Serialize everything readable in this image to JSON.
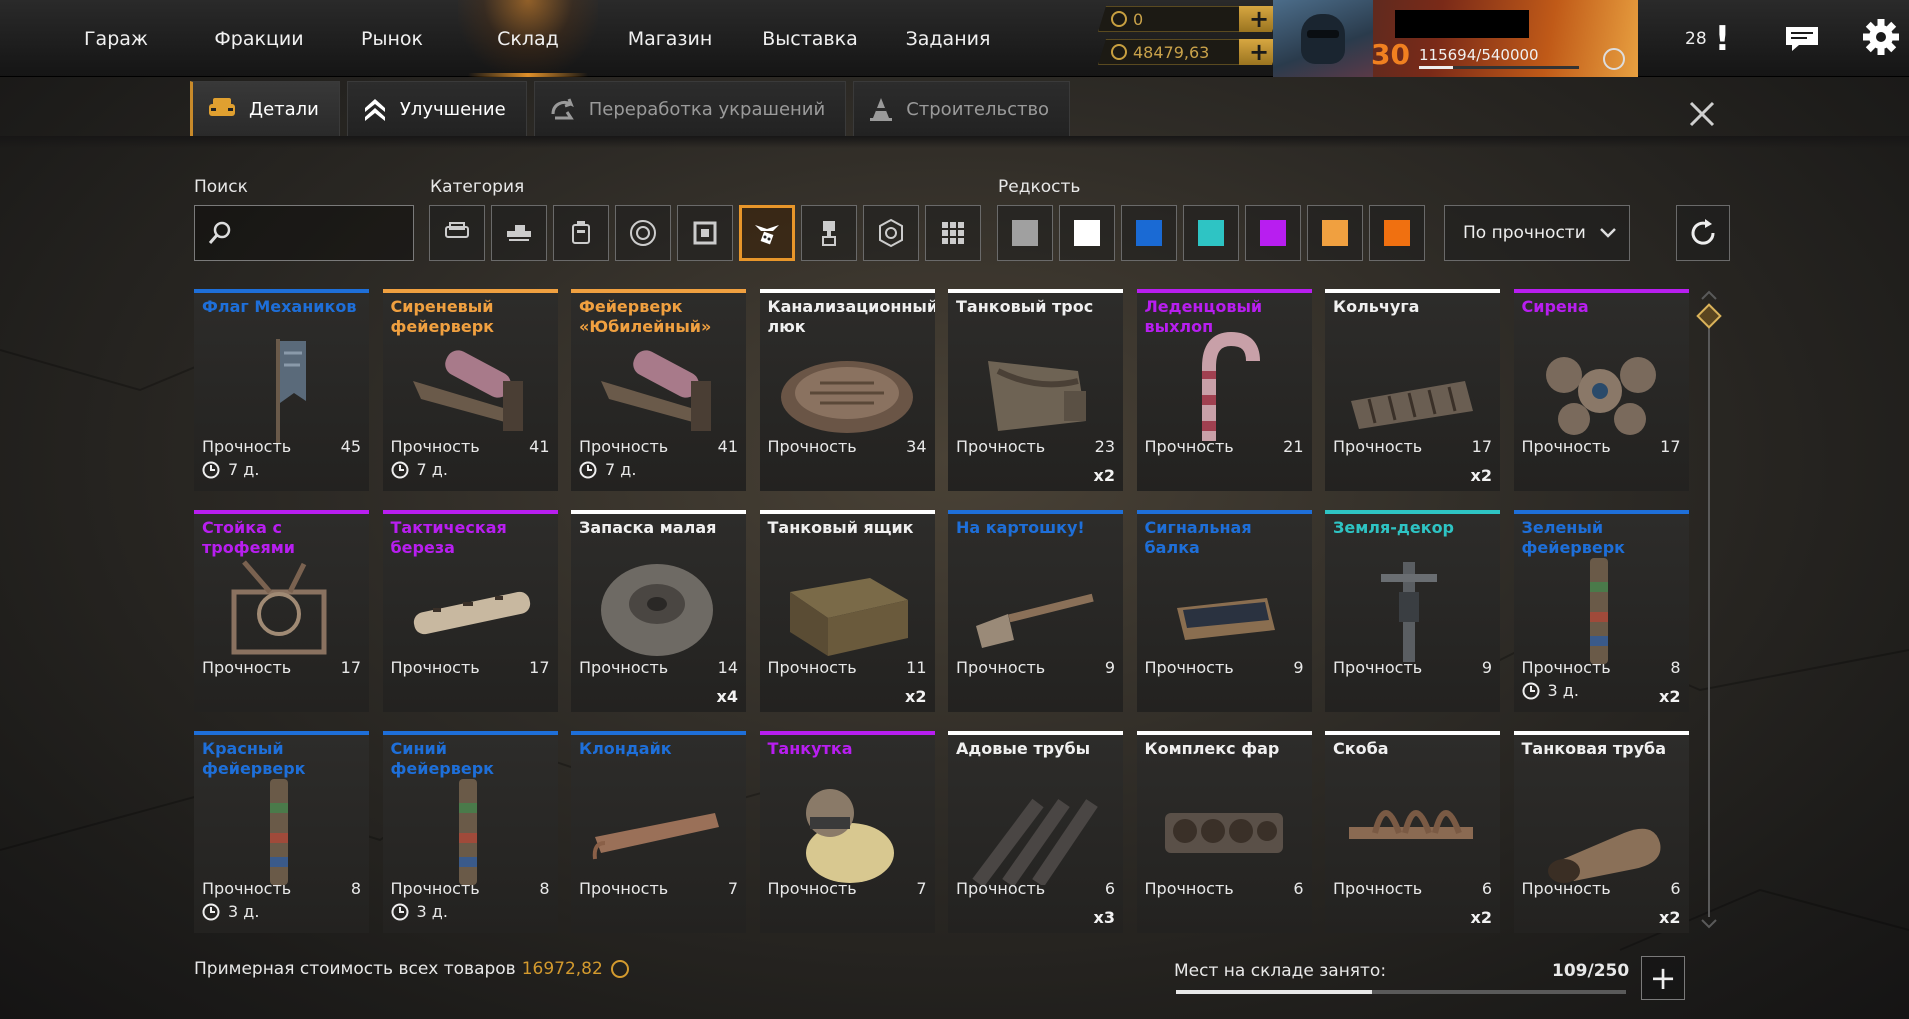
{
  "nav": {
    "items": [
      "Гараж",
      "Фракции",
      "Рынок",
      "Склад",
      "Магазин",
      "Выставка",
      "Задания"
    ],
    "active": "Склад"
  },
  "currency": {
    "coupons": "0",
    "coins": "48479,63"
  },
  "player": {
    "level": "30",
    "xp": "115694/540000",
    "xp_fraction": 0.214
  },
  "notifications": {
    "count": "28"
  },
  "subtabs": [
    "Детали",
    "Улучшение",
    "Переработка украшений",
    "Строительство"
  ],
  "filters": {
    "search_label": "Поиск",
    "search_placeholder": "",
    "category_label": "Категория",
    "category_icons": [
      "car-icon",
      "weapon-icon",
      "module-icon",
      "wheel-icon",
      "frame-icon",
      "decor-icon",
      "paint-icon",
      "hex-part-icon",
      "grid-icon"
    ],
    "active_category": 5,
    "rarity_label": "Редкость",
    "rarity_colors": [
      "#a0a0a0",
      "#ffffff",
      "#1a6ad4",
      "#2ec4c4",
      "#b81ef0",
      "#f0a040",
      "#f07010"
    ],
    "sort_label": "По прочности"
  },
  "rarity_colors": {
    "common": "#ffffff",
    "rare": "#1e6fd9",
    "special": "#2ec4c4",
    "epic": "#b81ef0",
    "legendary": "#f0a040"
  },
  "items": [
    {
      "name": "Флаг Механиков",
      "rarity": "rare",
      "durability_label": "Прочность",
      "durability": "45",
      "timer": "7 д.",
      "qty": "",
      "icon": "flag-icon"
    },
    {
      "name": "Сиреневый фейерверк",
      "rarity": "legendary",
      "durability_label": "Прочность",
      "durability": "41",
      "timer": "7 д.",
      "qty": "",
      "icon": "firework-launcher-icon"
    },
    {
      "name": "Фейерверк «Юбилейный»",
      "rarity": "legendary",
      "durability_label": "Прочность",
      "durability": "41",
      "timer": "7 д.",
      "qty": "",
      "icon": "firework-launcher-icon"
    },
    {
      "name": "Канализационный люк",
      "rarity": "common",
      "durability_label": "Прочность",
      "durability": "34",
      "timer": "",
      "qty": "",
      "icon": "manhole-icon"
    },
    {
      "name": "Танковый трос",
      "rarity": "common",
      "durability_label": "Прочность",
      "durability": "23",
      "timer": "",
      "qty": "x2",
      "icon": "tank-rope-icon"
    },
    {
      "name": "Леденцовый выхлоп",
      "rarity": "epic",
      "durability_label": "Прочность",
      "durability": "21",
      "timer": "",
      "qty": "",
      "icon": "candy-cane-icon"
    },
    {
      "name": "Кольчуга",
      "rarity": "common",
      "durability_label": "Прочность",
      "durability": "17",
      "timer": "",
      "qty": "x2",
      "icon": "chainmail-icon"
    },
    {
      "name": "Сирена",
      "rarity": "epic",
      "durability_label": "Прочность",
      "durability": "17",
      "timer": "",
      "qty": "",
      "icon": "siren-icon"
    },
    {
      "name": "Стойка с трофеями",
      "rarity": "epic",
      "durability_label": "Прочность",
      "durability": "17",
      "timer": "",
      "qty": "",
      "icon": "trophy-rack-icon"
    },
    {
      "name": "Тактическая береза",
      "rarity": "epic",
      "durability_label": "Прочность",
      "durability": "17",
      "timer": "",
      "qty": "",
      "icon": "birch-log-icon"
    },
    {
      "name": "Запаска малая",
      "rarity": "common",
      "durability_label": "Прочность",
      "durability": "14",
      "timer": "",
      "qty": "x4",
      "icon": "spare-tire-icon"
    },
    {
      "name": "Танковый ящик",
      "rarity": "common",
      "durability_label": "Прочность",
      "durability": "11",
      "timer": "",
      "qty": "x2",
      "icon": "tank-box-icon"
    },
    {
      "name": "На картошку!",
      "rarity": "rare",
      "durability_label": "Прочность",
      "durability": "9",
      "timer": "",
      "qty": "",
      "icon": "shovel-icon"
    },
    {
      "name": "Сигнальная балка",
      "rarity": "rare",
      "durability_label": "Прочность",
      "durability": "9",
      "timer": "",
      "qty": "",
      "icon": "signal-bar-icon"
    },
    {
      "name": "Земля-декор",
      "rarity": "special",
      "durability_label": "Прочность",
      "durability": "9",
      "timer": "",
      "qty": "",
      "icon": "drill-icon"
    },
    {
      "name": "Зеленый фейерверк",
      "rarity": "rare",
      "durability_label": "Прочность",
      "durability": "8",
      "timer": "3 д.",
      "qty": "x2",
      "icon": "firework-tube-icon"
    },
    {
      "name": "Красный фейерверк",
      "rarity": "rare",
      "durability_label": "Прочность",
      "durability": "8",
      "timer": "3 д.",
      "qty": "",
      "icon": "firework-tube-icon"
    },
    {
      "name": "Синий фейерверк",
      "rarity": "rare",
      "durability_label": "Прочность",
      "durability": "8",
      "timer": "3 д.",
      "qty": "",
      "icon": "firework-tube-icon"
    },
    {
      "name": "Клондайк",
      "rarity": "rare",
      "durability_label": "Прочность",
      "durability": "7",
      "timer": "",
      "qty": "",
      "icon": "sled-icon"
    },
    {
      "name": "Танкутка",
      "rarity": "epic",
      "durability_label": "Прочность",
      "durability": "7",
      "timer": "",
      "qty": "",
      "icon": "duck-icon"
    },
    {
      "name": "Адовые трубы",
      "rarity": "common",
      "durability_label": "Прочность",
      "durability": "6",
      "timer": "",
      "qty": "x3",
      "icon": "exhaust-pipes-icon"
    },
    {
      "name": "Комплекс фар",
      "rarity": "common",
      "durability_label": "Прочность",
      "durability": "6",
      "timer": "",
      "qty": "",
      "icon": "headlights-icon"
    },
    {
      "name": "Скоба",
      "rarity": "common",
      "durability_label": "Прочность",
      "durability": "6",
      "timer": "",
      "qty": "x2",
      "icon": "bracket-icon"
    },
    {
      "name": "Танковая труба",
      "rarity": "common",
      "durability_label": "Прочность",
      "durability": "6",
      "timer": "",
      "qty": "x2",
      "icon": "tank-pipe-icon"
    }
  ],
  "footer": {
    "total_label": "Примерная стоимость всех товаров",
    "total_value": "16972,82",
    "storage_label": "Мест на складе занято:",
    "storage_count": "109/250",
    "storage_fraction": 0.436
  }
}
